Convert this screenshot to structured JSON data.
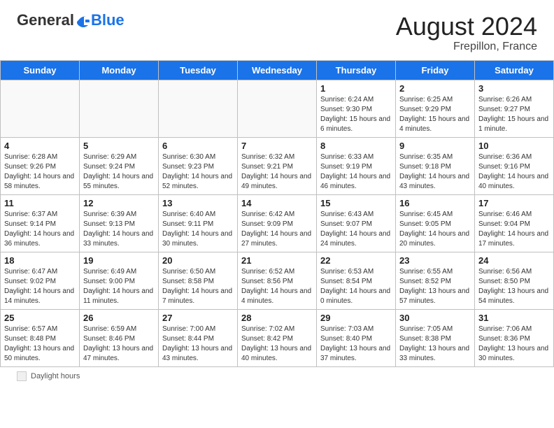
{
  "header": {
    "logo_general": "General",
    "logo_blue": "Blue",
    "month_year": "August 2024",
    "location": "Frepillon, France"
  },
  "days_of_week": [
    "Sunday",
    "Monday",
    "Tuesday",
    "Wednesday",
    "Thursday",
    "Friday",
    "Saturday"
  ],
  "footer": {
    "label": "Daylight hours"
  },
  "weeks": [
    [
      {
        "day": "",
        "sunrise": "",
        "sunset": "",
        "daylight": ""
      },
      {
        "day": "",
        "sunrise": "",
        "sunset": "",
        "daylight": ""
      },
      {
        "day": "",
        "sunrise": "",
        "sunset": "",
        "daylight": ""
      },
      {
        "day": "",
        "sunrise": "",
        "sunset": "",
        "daylight": ""
      },
      {
        "day": "1",
        "sunrise": "6:24 AM",
        "sunset": "9:30 PM",
        "daylight": "15 hours and 6 minutes."
      },
      {
        "day": "2",
        "sunrise": "6:25 AM",
        "sunset": "9:29 PM",
        "daylight": "15 hours and 4 minutes."
      },
      {
        "day": "3",
        "sunrise": "6:26 AM",
        "sunset": "9:27 PM",
        "daylight": "15 hours and 1 minute."
      }
    ],
    [
      {
        "day": "4",
        "sunrise": "6:28 AM",
        "sunset": "9:26 PM",
        "daylight": "14 hours and 58 minutes."
      },
      {
        "day": "5",
        "sunrise": "6:29 AM",
        "sunset": "9:24 PM",
        "daylight": "14 hours and 55 minutes."
      },
      {
        "day": "6",
        "sunrise": "6:30 AM",
        "sunset": "9:23 PM",
        "daylight": "14 hours and 52 minutes."
      },
      {
        "day": "7",
        "sunrise": "6:32 AM",
        "sunset": "9:21 PM",
        "daylight": "14 hours and 49 minutes."
      },
      {
        "day": "8",
        "sunrise": "6:33 AM",
        "sunset": "9:19 PM",
        "daylight": "14 hours and 46 minutes."
      },
      {
        "day": "9",
        "sunrise": "6:35 AM",
        "sunset": "9:18 PM",
        "daylight": "14 hours and 43 minutes."
      },
      {
        "day": "10",
        "sunrise": "6:36 AM",
        "sunset": "9:16 PM",
        "daylight": "14 hours and 40 minutes."
      }
    ],
    [
      {
        "day": "11",
        "sunrise": "6:37 AM",
        "sunset": "9:14 PM",
        "daylight": "14 hours and 36 minutes."
      },
      {
        "day": "12",
        "sunrise": "6:39 AM",
        "sunset": "9:13 PM",
        "daylight": "14 hours and 33 minutes."
      },
      {
        "day": "13",
        "sunrise": "6:40 AM",
        "sunset": "9:11 PM",
        "daylight": "14 hours and 30 minutes."
      },
      {
        "day": "14",
        "sunrise": "6:42 AM",
        "sunset": "9:09 PM",
        "daylight": "14 hours and 27 minutes."
      },
      {
        "day": "15",
        "sunrise": "6:43 AM",
        "sunset": "9:07 PM",
        "daylight": "14 hours and 24 minutes."
      },
      {
        "day": "16",
        "sunrise": "6:45 AM",
        "sunset": "9:05 PM",
        "daylight": "14 hours and 20 minutes."
      },
      {
        "day": "17",
        "sunrise": "6:46 AM",
        "sunset": "9:04 PM",
        "daylight": "14 hours and 17 minutes."
      }
    ],
    [
      {
        "day": "18",
        "sunrise": "6:47 AM",
        "sunset": "9:02 PM",
        "daylight": "14 hours and 14 minutes."
      },
      {
        "day": "19",
        "sunrise": "6:49 AM",
        "sunset": "9:00 PM",
        "daylight": "14 hours and 11 minutes."
      },
      {
        "day": "20",
        "sunrise": "6:50 AM",
        "sunset": "8:58 PM",
        "daylight": "14 hours and 7 minutes."
      },
      {
        "day": "21",
        "sunrise": "6:52 AM",
        "sunset": "8:56 PM",
        "daylight": "14 hours and 4 minutes."
      },
      {
        "day": "22",
        "sunrise": "6:53 AM",
        "sunset": "8:54 PM",
        "daylight": "14 hours and 0 minutes."
      },
      {
        "day": "23",
        "sunrise": "6:55 AM",
        "sunset": "8:52 PM",
        "daylight": "13 hours and 57 minutes."
      },
      {
        "day": "24",
        "sunrise": "6:56 AM",
        "sunset": "8:50 PM",
        "daylight": "13 hours and 54 minutes."
      }
    ],
    [
      {
        "day": "25",
        "sunrise": "6:57 AM",
        "sunset": "8:48 PM",
        "daylight": "13 hours and 50 minutes."
      },
      {
        "day": "26",
        "sunrise": "6:59 AM",
        "sunset": "8:46 PM",
        "daylight": "13 hours and 47 minutes."
      },
      {
        "day": "27",
        "sunrise": "7:00 AM",
        "sunset": "8:44 PM",
        "daylight": "13 hours and 43 minutes."
      },
      {
        "day": "28",
        "sunrise": "7:02 AM",
        "sunset": "8:42 PM",
        "daylight": "13 hours and 40 minutes."
      },
      {
        "day": "29",
        "sunrise": "7:03 AM",
        "sunset": "8:40 PM",
        "daylight": "13 hours and 37 minutes."
      },
      {
        "day": "30",
        "sunrise": "7:05 AM",
        "sunset": "8:38 PM",
        "daylight": "13 hours and 33 minutes."
      },
      {
        "day": "31",
        "sunrise": "7:06 AM",
        "sunset": "8:36 PM",
        "daylight": "13 hours and 30 minutes."
      }
    ]
  ]
}
